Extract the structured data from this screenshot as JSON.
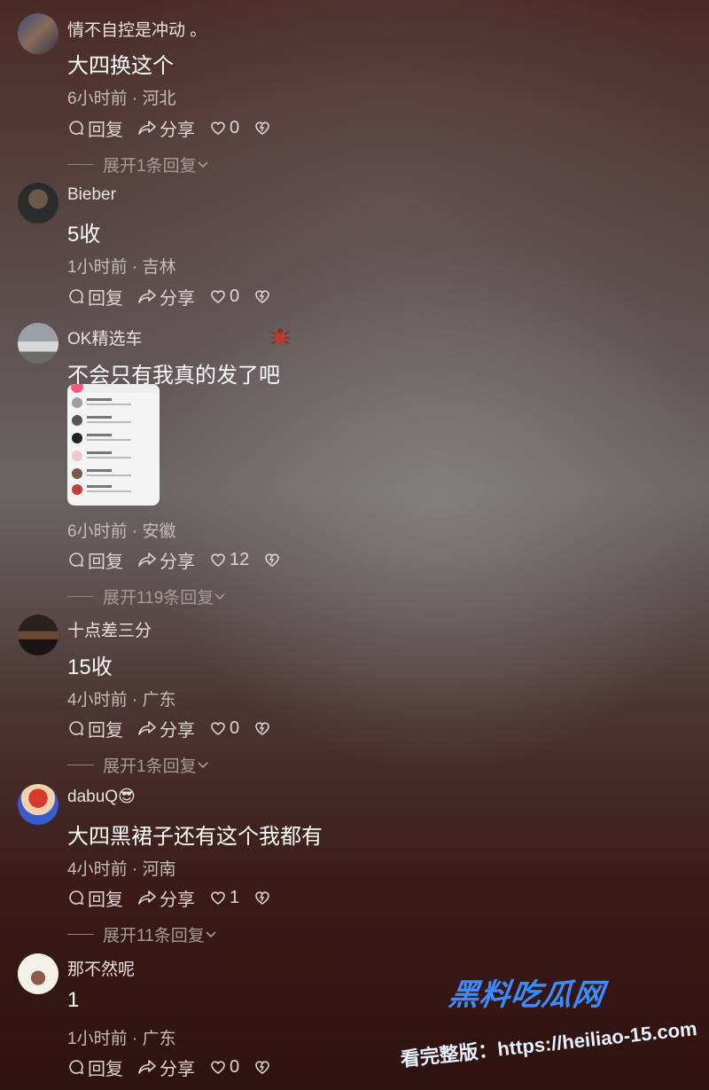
{
  "actions": {
    "reply": "回复",
    "share": "分享"
  },
  "comments": [
    {
      "user": "情不自控是冲动 。",
      "text": "大四换这个",
      "meta": "6小时前 · 河北",
      "likes": "0",
      "expand": "展开1条回复"
    },
    {
      "user": "Bieber",
      "text": "5收",
      "meta": "1小时前 · 吉林",
      "likes": "0"
    },
    {
      "user": "OK精选车",
      "text": "不会只有我真的发了吧",
      "meta": "6小时前 · 安徽",
      "likes": "12",
      "expand": "展开119条回复"
    },
    {
      "user": "十点差三分",
      "text": "15收",
      "meta": "4小时前 · 广东",
      "likes": "0",
      "expand": "展开1条回复"
    },
    {
      "user": "dabuQ😎",
      "text": "大四黑裙子还有这个我都有",
      "meta": "4小时前 · 河南",
      "likes": "1",
      "expand": "展开11条回复"
    },
    {
      "user": "那不然呢",
      "text": "1",
      "meta": "1小时前 · 广东",
      "likes": "0"
    }
  ],
  "watermark": {
    "title": "黑料吃瓜网",
    "url": "看完整版：https://heiliao-15.com"
  },
  "colors": {
    "accent": "#3a8cff",
    "bug": "#c0392b"
  }
}
